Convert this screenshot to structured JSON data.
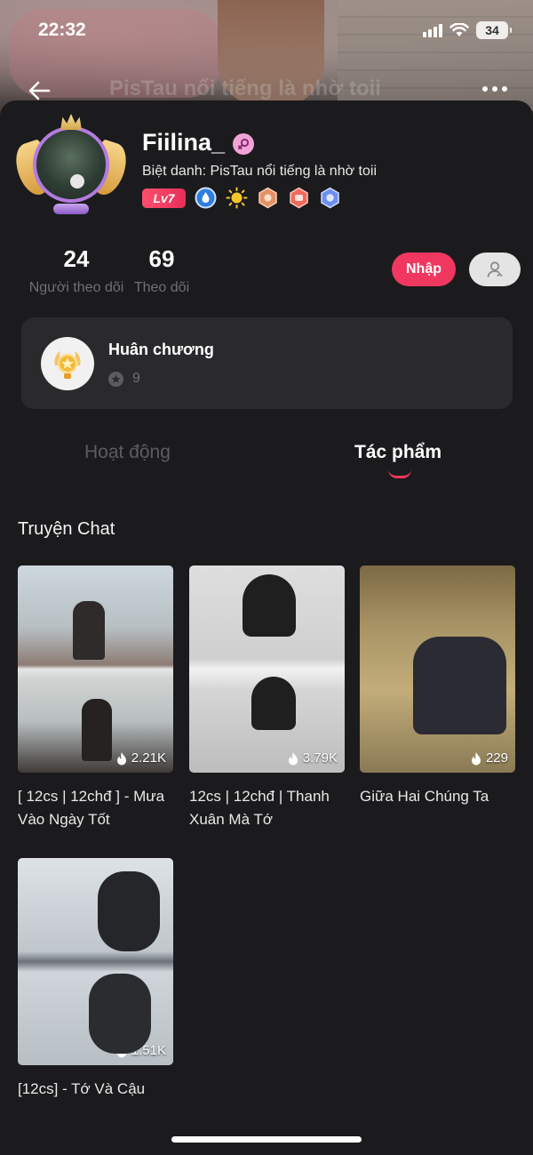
{
  "status_bar": {
    "time": "22:32",
    "battery": "34"
  },
  "nav": {
    "cover_title": "PisTau nổi tiếng là nhờ toii"
  },
  "profile": {
    "username": "Fiilina_",
    "nickname": "Biệt danh: PisTau nổi tiếng là nhờ toii",
    "level": "Lv7",
    "badge_icons": [
      "water-drop-icon",
      "sun-icon",
      "hexagon-bronze-icon",
      "hexagon-red-icon",
      "hexagon-blue-icon"
    ]
  },
  "stats": [
    {
      "value": "24",
      "label": "Người theo dõi"
    },
    {
      "value": "69",
      "label": "Theo dõi"
    }
  ],
  "actions": {
    "follow_label": "Nhập"
  },
  "medal": {
    "title": "Huân chương",
    "count": "9"
  },
  "tabs": [
    {
      "label": "Hoạt động",
      "active": false
    },
    {
      "label": "Tác phẩm",
      "active": true
    }
  ],
  "section": {
    "title": "Truyện Chat",
    "items": [
      {
        "title": "[ 12cs | 12chđ ] - Mưa Vào Ngày Tốt",
        "views": "2.21K"
      },
      {
        "title": "12cs | 12chđ | Thanh Xuân Mà Tớ",
        "views": "3.79K"
      },
      {
        "title": "Giữa Hai Chúng Ta",
        "views": "229"
      },
      {
        "title": "[12cs] - Tớ Và Cậu",
        "views": "1.51K"
      }
    ]
  },
  "colors": {
    "accent": "#f0375f",
    "background": "#1b1b1d",
    "card": "#2a2a2d",
    "muted": "#6f6f74"
  }
}
